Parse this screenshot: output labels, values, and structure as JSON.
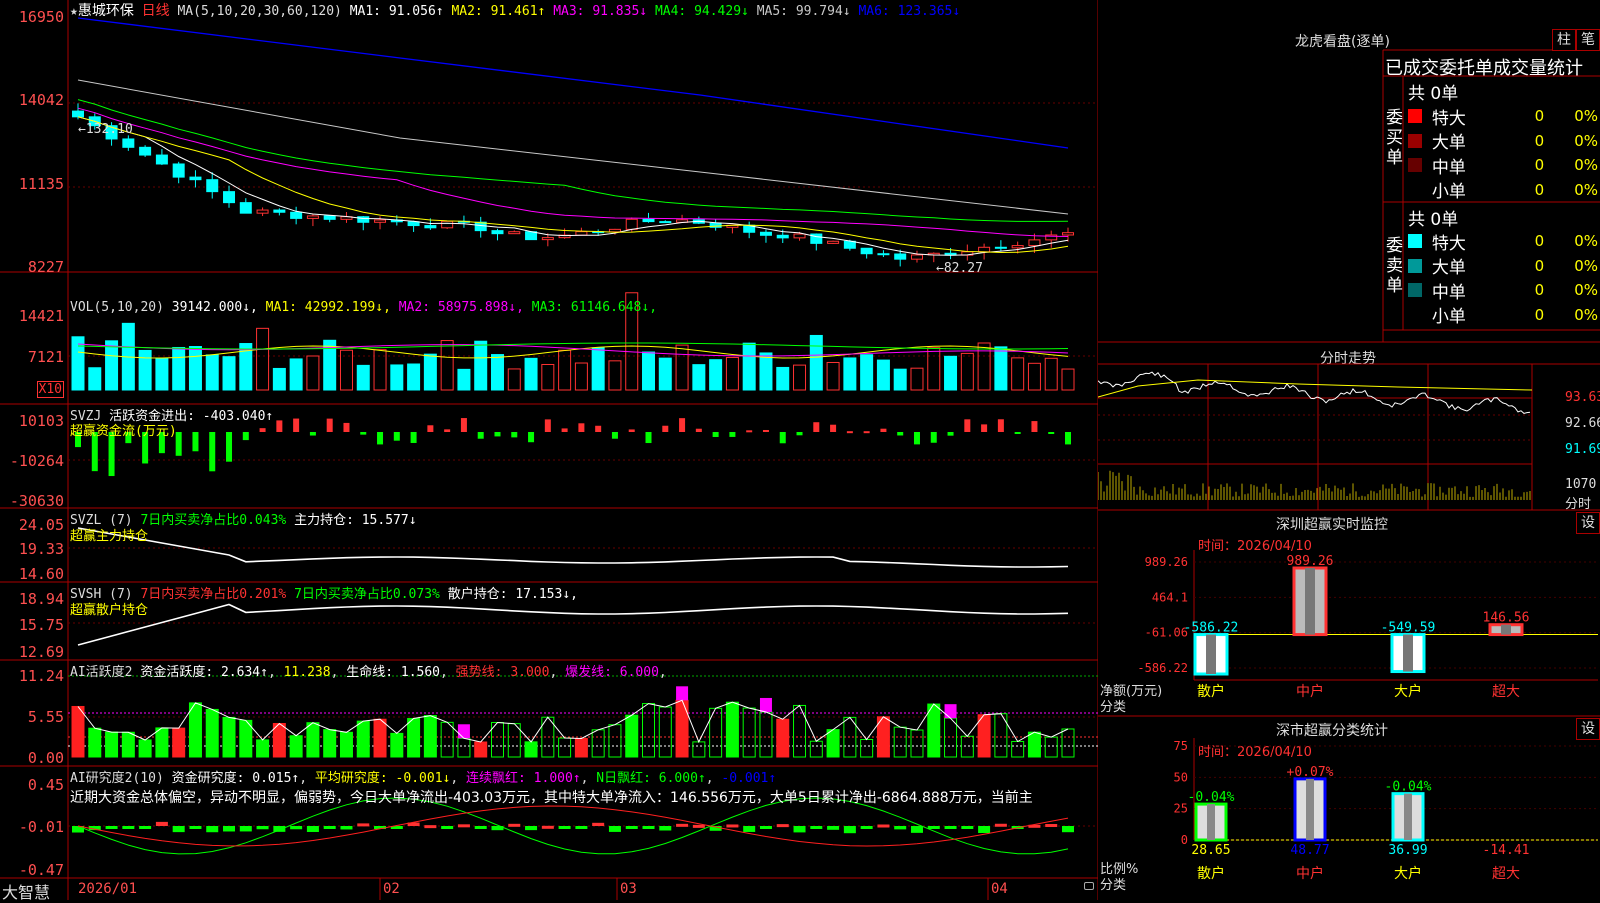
{
  "chart_header": {
    "star": "★",
    "stock_name": "惠城环保",
    "period": "日线",
    "ma_label": "MA(5,10,20,30,60,120)",
    "ma_values": [
      {
        "text": "MA1: 91.056↑",
        "color": "#ffffff"
      },
      {
        "text": "MA2: 91.461↑",
        "color": "#ffff00"
      },
      {
        "text": "MA3: 91.835↓",
        "color": "#ff00ff"
      },
      {
        "text": "MA4: 94.429↓",
        "color": "#00ff00"
      },
      {
        "text": "MA5: 99.794↓",
        "color": "#c8c8c8"
      },
      {
        "text": "MA6: 123.365↓",
        "color": "#0000ff"
      }
    ]
  },
  "price_axis": [
    "16950",
    "14042",
    "11135",
    "8227"
  ],
  "price_marks": {
    "high": "←132.10",
    "low": "←82.27"
  },
  "vol_header": {
    "label": "VOL(5,10,20)",
    "items": [
      {
        "text": "39142.000↓",
        "color": "#ffffff"
      },
      {
        "text": "MA1: 42992.199↓",
        "color": "#ffff00"
      },
      {
        "text": "MA2: 58975.898↓",
        "color": "#ff00ff"
      },
      {
        "text": "MA3: 61146.648↓",
        "color": "#00ff00"
      }
    ]
  },
  "vol_axis": [
    "14421",
    "7121",
    "X10"
  ],
  "svzj_header": {
    "label": "SVZJ",
    "item": "活跃资金进出: -403.040↑",
    "sub": "超赢资金流(万元)"
  },
  "svzj_axis": [
    "10103",
    "-10264",
    "-30630"
  ],
  "svzl_header": {
    "label": "SVZL (7)",
    "item1": "7日内买卖净占比0.043%",
    "item2": "主力持仓: 15.577↓",
    "sub": "超赢主力持仓"
  },
  "svzl_axis": [
    "24.05",
    "19.33",
    "14.60"
  ],
  "svsh_header": {
    "label": "SVSH (7)",
    "item1": "7日内买卖净占比0.201%",
    "item2": "7日内买卖净占比0.073%",
    "item3": "散户持仓: 17.153↓,",
    "sub": "超赢散户持仓"
  },
  "svsh_axis": [
    "18.94",
    "15.75",
    "12.69"
  ],
  "ai2_header": {
    "label": "AI活跃度2",
    "item1": "资金活跃度: 2.634↑",
    "item2": "11.238",
    "item3": "生命线: 1.560",
    "item4": "强势线: 3.000",
    "item5": "爆发线: 6.000"
  },
  "ai2_axis": [
    "11.24",
    "5.55",
    "0.00"
  ],
  "air_header": {
    "label": "AI研究度2(10)",
    "item1": "资金研究度: 0.015↑",
    "item2": "平均研究度: -0.001↓",
    "item3": "连续飘红: 1.000↑",
    "item4": "N日飘红: 6.000↑",
    "item5": "-0.001↑"
  },
  "air_note": "近期大资金总体偏空，异动不明显，偏弱势，今日大单净流出-403.03万元，其中特大单净流入：146.556万元，大单5日累计净出-6864.888万元，当前主",
  "air_axis": [
    "0.45",
    "-0.01",
    "-0.47"
  ],
  "time_axis": [
    "2026/01",
    "02",
    "03",
    "04"
  ],
  "brand": "大智慧",
  "right_panel": {
    "lhb": {
      "title": "龙虎看盘(逐单)",
      "tab_column": "柱",
      "tab_stroke": "笔",
      "heading": "已成交委托单成交量统计",
      "buy_label": "委买单",
      "sell_label": "委卖单",
      "buy_total": "共 0单",
      "sell_total": "共 0单",
      "buy_rows": [
        {
          "name": "特大",
          "count": "0",
          "pct": "0%",
          "color": "#ff0000"
        },
        {
          "name": "大单",
          "count": "0",
          "pct": "0%",
          "color": "#990000"
        },
        {
          "name": "中单",
          "count": "0",
          "pct": "0%",
          "color": "#660000"
        },
        {
          "name": "小单",
          "count": "0",
          "pct": "0%",
          "color": "#000000"
        }
      ],
      "sell_rows": [
        {
          "name": "特大",
          "count": "0",
          "pct": "0%",
          "color": "#00ffff"
        },
        {
          "name": "大单",
          "count": "0",
          "pct": "0%",
          "color": "#009999"
        },
        {
          "name": "中单",
          "count": "0",
          "pct": "0%",
          "color": "#006666"
        },
        {
          "name": "小单",
          "count": "0",
          "pct": "0%",
          "color": "#000000"
        }
      ]
    },
    "fenshi": {
      "title": "分时走势",
      "axis": [
        "93.63",
        "92.66",
        "91.69"
      ],
      "vol_axis": "1070",
      "unit": "分时"
    },
    "sz_realtime": {
      "title": "深圳超赢实时监控",
      "settings": "设",
      "date_label": "时间：2026/04/10",
      "axis": [
        "989.26",
        "464.1",
        "-61.06",
        "-586.22"
      ],
      "y_title": "净额(万元)",
      "x_title": "分类",
      "bars": [
        {
          "cat": "散户",
          "value": -586.22,
          "label": "-586.22"
        },
        {
          "cat": "中户",
          "value": 989.26,
          "label": "989.26"
        },
        {
          "cat": "大户",
          "value": -549.59,
          "label": "-549.59"
        },
        {
          "cat": "超大",
          "value": 146.56,
          "label": "146.56"
        }
      ]
    },
    "sz_class": {
      "title": "深市超赢分类统计",
      "settings": "设",
      "date_label": "时间：2026/04/10",
      "axis": [
        "75",
        "50",
        "25",
        "0"
      ],
      "y_title": "比例%",
      "x_title": "分类",
      "bars": [
        {
          "cat": "散户",
          "value": 28.65,
          "change": "-0.04%",
          "label": "28.65"
        },
        {
          "cat": "中户",
          "value": 48.77,
          "change": "+0.07%",
          "label": "48.77"
        },
        {
          "cat": "大户",
          "value": 36.99,
          "change": "-0.04%",
          "label": "36.99"
        },
        {
          "cat": "超大",
          "value": -14.41,
          "change": "",
          "label": "-14.41"
        }
      ]
    }
  },
  "chart_data": [
    {
      "type": "candlestick",
      "title": "惠城环保 日线",
      "ylim": [
        8227,
        16950
      ],
      "labels": [
        "2026/01",
        "02",
        "03",
        "04"
      ]
    },
    {
      "type": "bar",
      "title": "VOL(5,10,20)",
      "ylim": [
        0,
        14421
      ]
    },
    {
      "type": "bar",
      "title": "超赢资金流(万元)",
      "ylim": [
        -30630,
        10103
      ]
    }
  ],
  "colors": {
    "up": "#ff3232",
    "down": "#00ffff",
    "grid": "#aa0000",
    "axis_text": "#ff5050"
  }
}
